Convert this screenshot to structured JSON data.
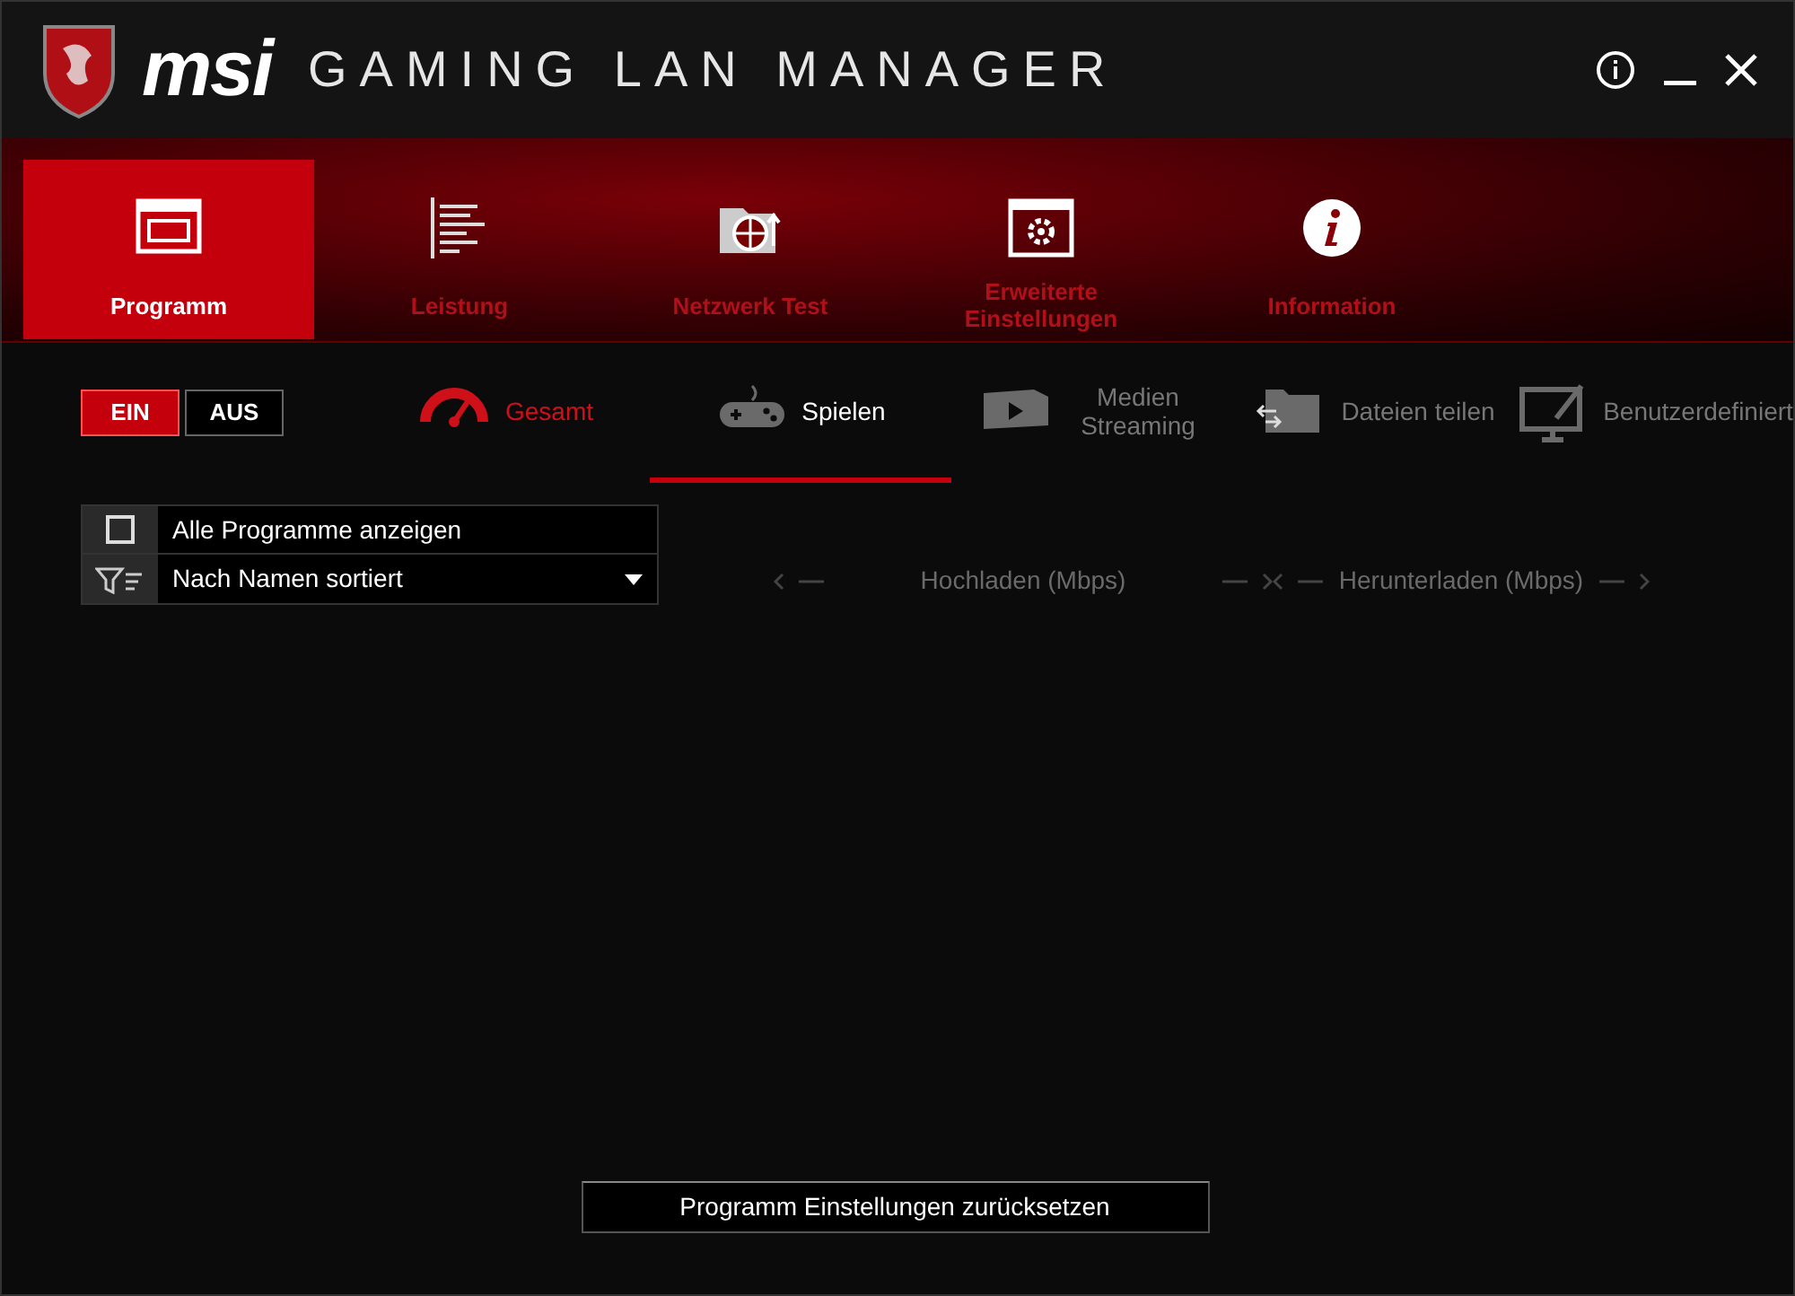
{
  "window": {
    "brand": "msi",
    "title": "GAMING LAN MANAGER"
  },
  "main_tabs": [
    {
      "label": "Programm",
      "selected": true
    },
    {
      "label": "Leistung",
      "selected": false
    },
    {
      "label": "Netzwerk Test",
      "selected": false
    },
    {
      "label": "Erweiterte Einstellungen",
      "selected": false
    },
    {
      "label": "Information",
      "selected": false
    }
  ],
  "power_toggle": {
    "on_label": "EIN",
    "off_label": "AUS",
    "on": true
  },
  "mode_tabs": [
    {
      "label": "Gesamt",
      "selected": false,
      "active": true
    },
    {
      "label": "Spielen",
      "selected": true,
      "active": false
    },
    {
      "label": "Medien Streaming",
      "selected": false,
      "active": false
    },
    {
      "label": "Dateien teilen",
      "selected": false,
      "active": false
    },
    {
      "label": "Benutzerdefiniert",
      "selected": false,
      "active": false
    }
  ],
  "filter": {
    "show_all_label": "Alle Programme anzeigen",
    "show_all_checked": false,
    "sort_value": "Nach Namen sortiert"
  },
  "columns": [
    "Hochladen (Mbps)",
    "Herunterladen (Mbps)"
  ],
  "reset_button": "Programm Einstellungen zurücksetzen"
}
